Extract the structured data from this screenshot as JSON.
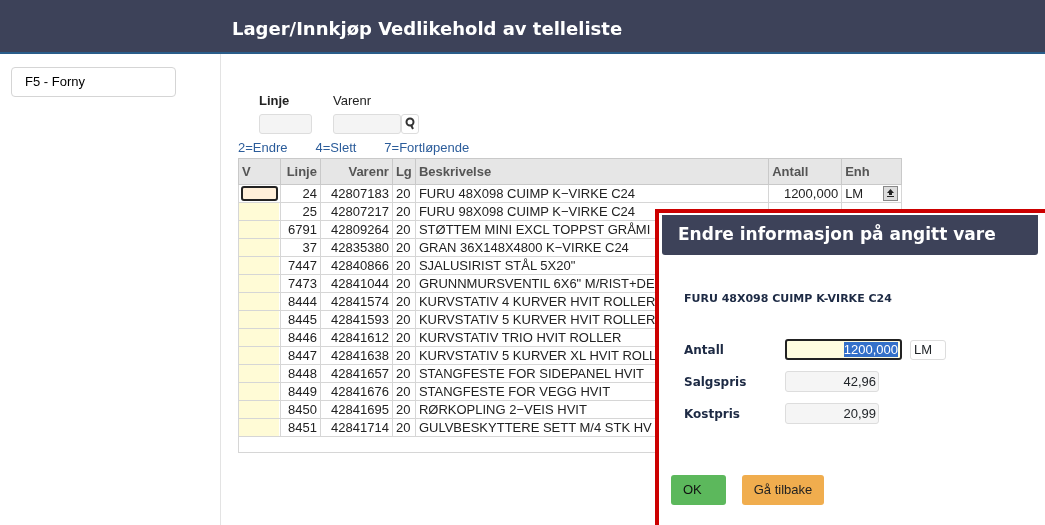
{
  "header": {
    "title": "Lager/Innkjøp Vedlikehold av telleliste"
  },
  "sidebar": {
    "buttons": [
      {
        "label": "F5 - Forny"
      }
    ]
  },
  "filter": {
    "fields": [
      {
        "label": "Linje",
        "kind": "plain"
      },
      {
        "label": "Varenr",
        "kind": "search"
      }
    ]
  },
  "legend": [
    "2=Endre",
    "4=Slett",
    "7=Fortløpende"
  ],
  "table": {
    "columns": [
      "V",
      "Linje",
      "Varenr",
      "Lg",
      "Beskrivelse",
      "Antall",
      "Enh"
    ],
    "rows": [
      {
        "selected": true,
        "linje": "24",
        "varenr": "42807183",
        "lg": "20",
        "beskrivelse": "FURU 48X098 CUIMP K−VIRKE C24",
        "antall": "1200,000",
        "enh": "LM"
      },
      {
        "selected": false,
        "linje": "25",
        "varenr": "42807217",
        "lg": "20",
        "beskrivelse": "FURU 98X098 CUIMP K−VIRKE C24"
      },
      {
        "selected": false,
        "linje": "6791",
        "varenr": "42809264",
        "lg": "20",
        "beskrivelse": "STØTTEM MINI EXCL TOPPST GRÅMI"
      },
      {
        "selected": false,
        "linje": "37",
        "varenr": "42835380",
        "lg": "20",
        "beskrivelse": "GRAN 36X148X4800 K−VIRKE C24"
      },
      {
        "selected": false,
        "linje": "7447",
        "varenr": "42840866",
        "lg": "20",
        "beskrivelse": "SJALUSIRIST STÅL 5X20\""
      },
      {
        "selected": false,
        "linje": "7473",
        "varenr": "42841044",
        "lg": "20",
        "beskrivelse": "GRUNNMURSVENTIL 6X6\" M/RIST+DE"
      },
      {
        "selected": false,
        "linje": "8444",
        "varenr": "42841574",
        "lg": "20",
        "beskrivelse": "KURVSTATIV 4 KURVER HVIT ROLLER"
      },
      {
        "selected": false,
        "linje": "8445",
        "varenr": "42841593",
        "lg": "20",
        "beskrivelse": "KURVSTATIV 5 KURVER HVIT ROLLER"
      },
      {
        "selected": false,
        "linje": "8446",
        "varenr": "42841612",
        "lg": "20",
        "beskrivelse": "KURVSTATIV TRIO HVIT ROLLER"
      },
      {
        "selected": false,
        "linje": "8447",
        "varenr": "42841638",
        "lg": "20",
        "beskrivelse": "KURVSTATIV 5 KURVER XL HVIT ROLL"
      },
      {
        "selected": false,
        "linje": "8448",
        "varenr": "42841657",
        "lg": "20",
        "beskrivelse": "STANGFESTE FOR SIDEPANEL HVIT"
      },
      {
        "selected": false,
        "linje": "8449",
        "varenr": "42841676",
        "lg": "20",
        "beskrivelse": "STANGFESTE FOR VEGG HVIT"
      },
      {
        "selected": false,
        "linje": "8450",
        "varenr": "42841695",
        "lg": "20",
        "beskrivelse": "RØRKOPLING 2−VEIS HVIT"
      },
      {
        "selected": false,
        "linje": "8451",
        "varenr": "42841714",
        "lg": "20",
        "beskrivelse": "GULVBESKYTTERE SETT M/4 STK HV"
      }
    ]
  },
  "dialog": {
    "title": "Endre informasjon på angitt vare",
    "product": "FURU 48X098 CUIMP K-VIRKE C24",
    "fields": [
      {
        "label": "Antall",
        "value": "1200,000",
        "unit": "LM",
        "kind": "editable"
      },
      {
        "label": "Salgspris",
        "value": "42,96",
        "kind": "readonly"
      },
      {
        "label": "Kostpris",
        "value": "20,99",
        "kind": "readonly"
      }
    ],
    "buttons": [
      {
        "label": "OK",
        "kind": "ok"
      },
      {
        "label": "Gå tilbake",
        "kind": "back"
      }
    ]
  }
}
